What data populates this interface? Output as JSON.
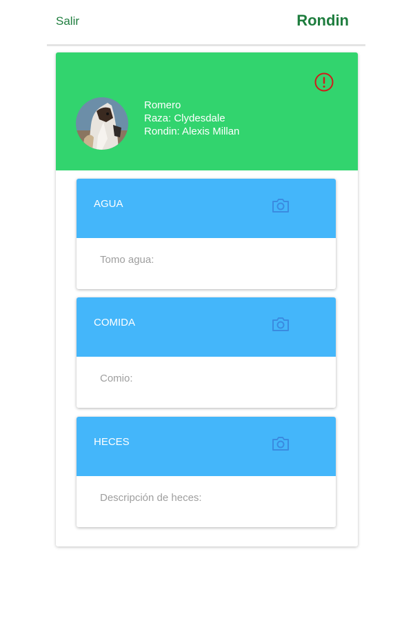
{
  "topbar": {
    "exit_label": "Salir",
    "title": "Rondin"
  },
  "horse": {
    "name": "Romero",
    "breed": "Raza: Clydesdale",
    "rondin": "Rondin: Alexis Millan",
    "avatar_icon": "horse-photo",
    "alert_icon": "alert-circle-icon"
  },
  "sections": [
    {
      "title": "AGUA",
      "placeholder": "Tomo agua:",
      "value": ""
    },
    {
      "title": "COMIDA",
      "placeholder": "Comio:",
      "value": ""
    },
    {
      "title": "HECES",
      "placeholder": "Descripción de heces:",
      "value": ""
    }
  ],
  "colors": {
    "accent_green": "#1e7d3e",
    "header_green": "#32d46e",
    "section_blue": "#44b6fa",
    "camera_blue": "#3a8be0",
    "alert_red": "#d11a1a"
  }
}
